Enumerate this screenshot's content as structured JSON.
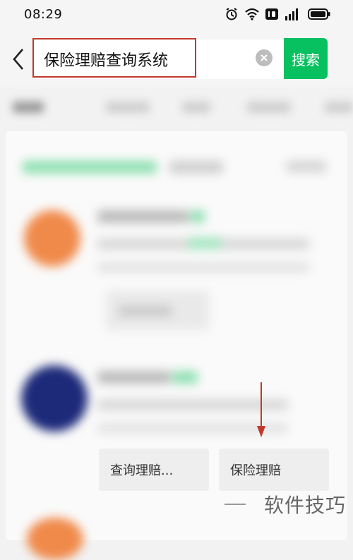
{
  "status_bar": {
    "time": "08:29",
    "icons": [
      "alarm-icon",
      "wifi-icon",
      "hd-icon",
      "4g-signal-icon",
      "battery-icon"
    ]
  },
  "search": {
    "query": "保险理赔查询系统",
    "button_label": "搜索",
    "accent_color": "#07c160",
    "highlight_color": "#c0392b"
  },
  "results": {
    "chips": [
      {
        "label": "查询理赔..."
      },
      {
        "label": "保险理赔"
      }
    ]
  },
  "watermark": {
    "text": "软件技巧"
  }
}
